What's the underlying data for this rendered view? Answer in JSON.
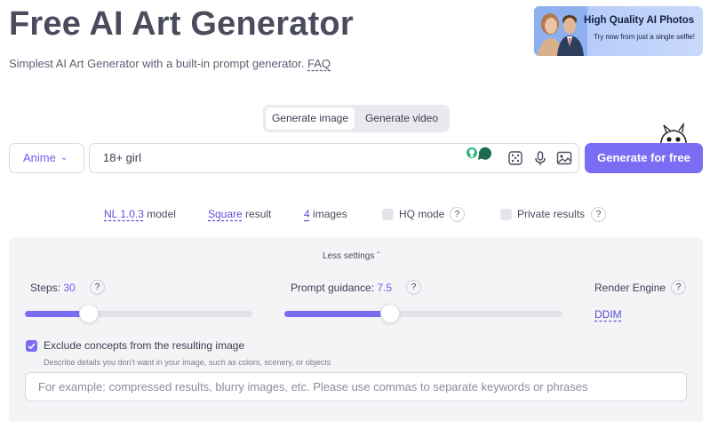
{
  "header": {
    "title": "Free AI Art Generator",
    "subtitle": "Simplest AI Art Generator with a built-in prompt generator.",
    "faq": "FAQ"
  },
  "ad": {
    "title": "High Quality AI Photos",
    "subtitle": "Try now from just a single selfie!"
  },
  "tabs": [
    {
      "label": "Generate image",
      "active": true
    },
    {
      "label": "Generate video",
      "active": false
    }
  ],
  "prompt_bar": {
    "style": "Anime",
    "prompt_text": "18+ girl",
    "generate_label": "Generate for free",
    "icons": [
      "lightbulb-chat-icon",
      "dice-icon",
      "microphone-icon",
      "image-icon"
    ]
  },
  "options": {
    "model_value": "NL 1.0.3",
    "model_suffix": "model",
    "result_value": "Square",
    "result_suffix": "result",
    "images_value": "4",
    "images_suffix": "images",
    "hq_mode_label": "HQ mode",
    "hq_mode_checked": false,
    "private_label": "Private results",
    "private_checked": false
  },
  "settings": {
    "toggle_label": "Less settings",
    "steps_label": "Steps:",
    "steps_value": "30",
    "steps_fraction": 0.28,
    "guidance_label": "Prompt guidance:",
    "guidance_value": "7.5",
    "guidance_fraction": 0.38,
    "render_engine_label": "Render Engine",
    "render_engine_value": "DDIM",
    "exclude_label": "Exclude concepts from the resulting image",
    "exclude_checked": true,
    "exclude_description": "Describe details you don't want in your image, such as colors, scenery, or objects",
    "negative_placeholder": "For example: compressed results, blurry images, etc. Please use commas to separate keywords or phrases"
  },
  "colors": {
    "accent": "#7a6cf3",
    "link": "#5a4fd8",
    "title": "#4a4c5e",
    "panel_bg": "#f4f4f7"
  }
}
